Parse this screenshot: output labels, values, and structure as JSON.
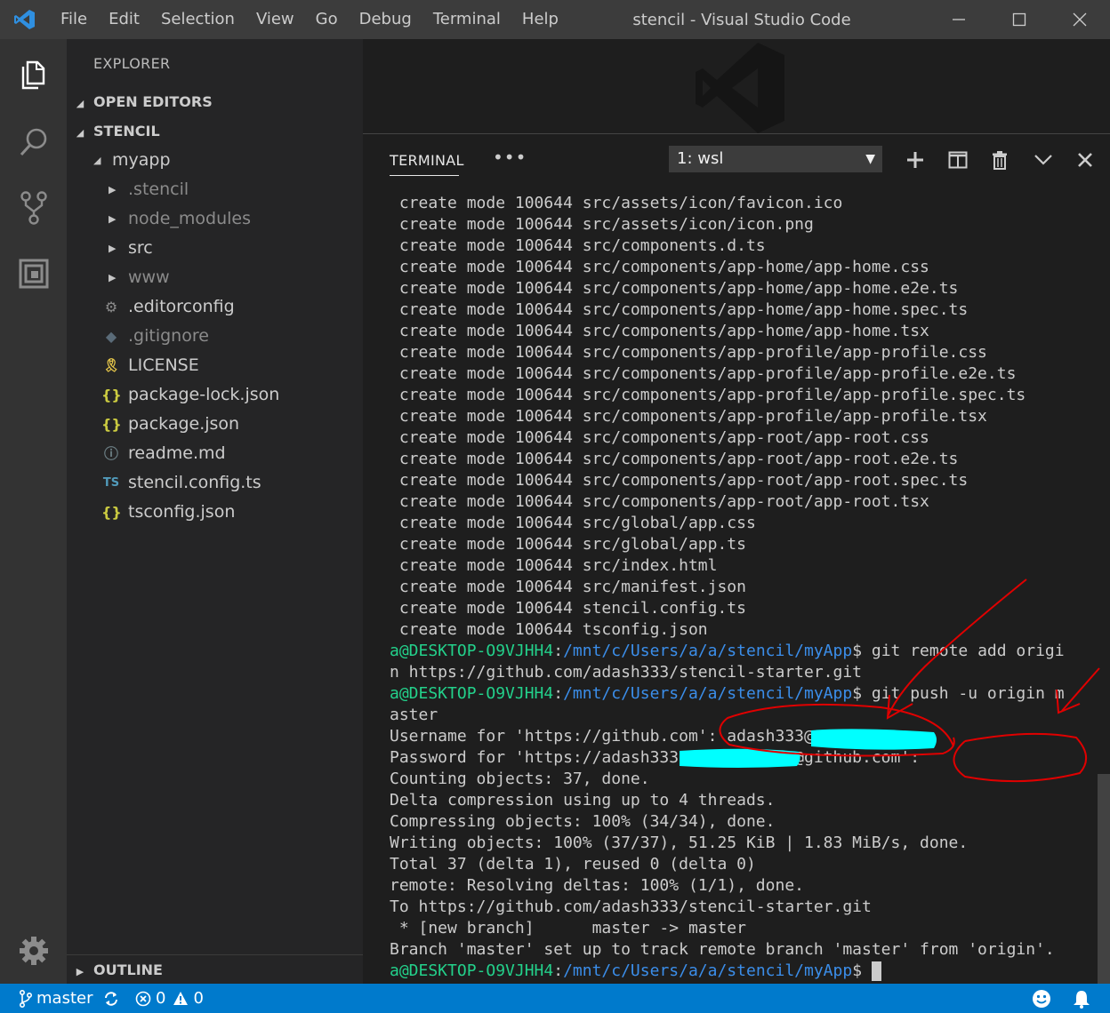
{
  "window": {
    "title": "stencil - Visual Studio Code",
    "menu": [
      "File",
      "Edit",
      "Selection",
      "View",
      "Go",
      "Debug",
      "Terminal",
      "Help"
    ]
  },
  "activity_bar": {
    "icons": [
      "files-icon",
      "search-icon",
      "source-control-icon",
      "extensions-icon",
      "settings-gear-icon"
    ]
  },
  "sidebar": {
    "title": "EXPLORER",
    "open_editors": "OPEN EDITORS",
    "workspace": "STENCIL",
    "outline": "OUTLINE",
    "tree": [
      {
        "label": "myapp",
        "type": "folder-open",
        "depth": 1,
        "dim": false
      },
      {
        "label": ".stencil",
        "type": "folder",
        "depth": 2,
        "dim": true
      },
      {
        "label": "node_modules",
        "type": "folder",
        "depth": 2,
        "dim": true
      },
      {
        "label": "src",
        "type": "folder",
        "depth": 2,
        "dim": false
      },
      {
        "label": "www",
        "type": "folder",
        "depth": 2,
        "dim": true
      },
      {
        "label": ".editorconfig",
        "type": "gear-file",
        "depth": 2,
        "dim": false
      },
      {
        "label": ".gitignore",
        "type": "git-file",
        "depth": 2,
        "dim": true
      },
      {
        "label": "LICENSE",
        "type": "license-file",
        "depth": 2,
        "dim": false
      },
      {
        "label": "package-lock.json",
        "type": "json-file",
        "depth": 2,
        "dim": false
      },
      {
        "label": "package.json",
        "type": "json-file",
        "depth": 2,
        "dim": false
      },
      {
        "label": "readme.md",
        "type": "info-file",
        "depth": 2,
        "dim": false
      },
      {
        "label": "stencil.config.ts",
        "type": "ts-file",
        "depth": 2,
        "dim": false
      },
      {
        "label": "tsconfig.json",
        "type": "json-file",
        "depth": 2,
        "dim": false
      }
    ]
  },
  "panel": {
    "tab": "TERMINAL",
    "more": "•••",
    "terminal_select": "1: wsl",
    "prompt_user": "a@DESKTOP-O9VJHH4",
    "prompt_path": "/mnt/c/Users/a/a/stencil/myApp",
    "lines": [
      {
        "t": " create mode 100644 src/assets/icon/favicon.ico"
      },
      {
        "t": " create mode 100644 src/assets/icon/icon.png"
      },
      {
        "t": " create mode 100644 src/components.d.ts"
      },
      {
        "t": " create mode 100644 src/components/app-home/app-home.css"
      },
      {
        "t": " create mode 100644 src/components/app-home/app-home.e2e.ts"
      },
      {
        "t": " create mode 100644 src/components/app-home/app-home.spec.ts"
      },
      {
        "t": " create mode 100644 src/components/app-home/app-home.tsx"
      },
      {
        "t": " create mode 100644 src/components/app-profile/app-profile.css"
      },
      {
        "t": " create mode 100644 src/components/app-profile/app-profile.e2e.ts"
      },
      {
        "t": " create mode 100644 src/components/app-profile/app-profile.spec.ts"
      },
      {
        "t": " create mode 100644 src/components/app-profile/app-profile.tsx"
      },
      {
        "t": " create mode 100644 src/components/app-root/app-root.css"
      },
      {
        "t": " create mode 100644 src/components/app-root/app-root.e2e.ts"
      },
      {
        "t": " create mode 100644 src/components/app-root/app-root.spec.ts"
      },
      {
        "t": " create mode 100644 src/components/app-root/app-root.tsx"
      },
      {
        "t": " create mode 100644 src/global/app.css"
      },
      {
        "t": " create mode 100644 src/global/app.ts"
      },
      {
        "t": " create mode 100644 src/index.html"
      },
      {
        "t": " create mode 100644 src/manifest.json"
      },
      {
        "t": " create mode 100644 stencil.config.ts"
      },
      {
        "t": " create mode 100644 tsconfig.json"
      },
      {
        "prompt": true,
        "cmd": " git remote add origi"
      },
      {
        "t": "n https://github.com/adash333/stencil-starter.git"
      },
      {
        "prompt": true,
        "cmd": " git push -u origin m"
      },
      {
        "t": "aster"
      },
      {
        "t": "Username for 'https://github.com': adash333@"
      },
      {
        "t": "Password for 'https://adash333            @github.com':"
      },
      {
        "t": "Counting objects: 37, done."
      },
      {
        "t": "Delta compression using up to 4 threads."
      },
      {
        "t": "Compressing objects: 100% (34/34), done."
      },
      {
        "t": "Writing objects: 100% (37/37), 51.25 KiB | 1.83 MiB/s, done."
      },
      {
        "t": "Total 37 (delta 1), reused 0 (delta 0)"
      },
      {
        "t": "remote: Resolving deltas: 100% (1/1), done."
      },
      {
        "t": "To https://github.com/adash333/stencil-starter.git"
      },
      {
        "t": " * [new branch]      master -> master"
      },
      {
        "t": "Branch 'master' set up to track remote branch 'master' from 'origin'."
      },
      {
        "prompt": true,
        "cmd": " ",
        "cursor": true
      }
    ]
  },
  "status_bar": {
    "branch": "master",
    "errors": "0",
    "warnings": "0",
    "colors": {
      "background": "#007acc"
    }
  }
}
